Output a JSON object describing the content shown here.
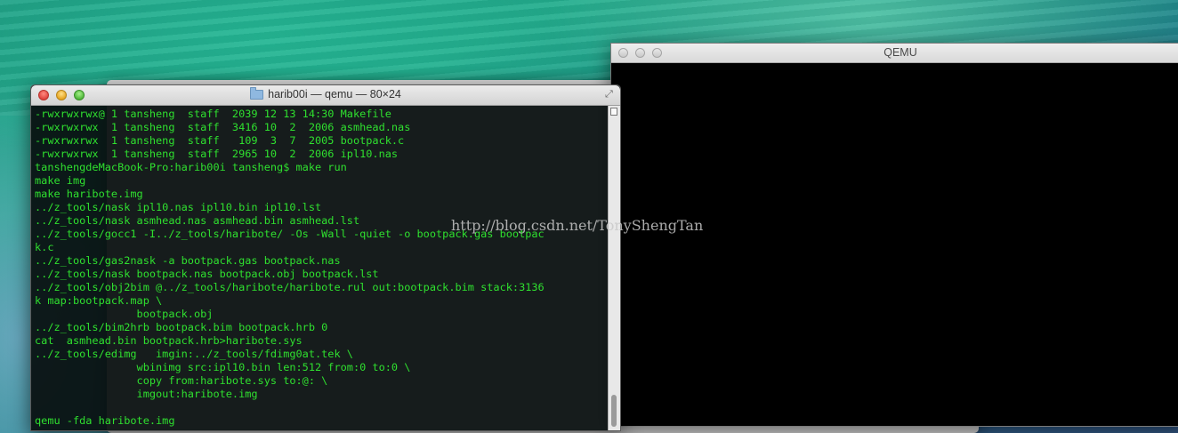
{
  "qemu_window": {
    "title": "QEMU"
  },
  "terminal": {
    "title": "harib00i — qemu — 80×24",
    "lines": [
      "-rwxrwxrwx@ 1 tansheng  staff  2039 12 13 14:30 Makefile",
      "-rwxrwxrwx  1 tansheng  staff  3416 10  2  2006 asmhead.nas",
      "-rwxrwxrwx  1 tansheng  staff   109  3  7  2005 bootpack.c",
      "-rwxrwxrwx  1 tansheng  staff  2965 10  2  2006 ipl10.nas",
      "tanshengdeMacBook-Pro:harib00i tansheng$ make run",
      "make img",
      "make haribote.img",
      "../z_tools/nask ipl10.nas ipl10.bin ipl10.lst",
      "../z_tools/nask asmhead.nas asmhead.bin asmhead.lst",
      "../z_tools/gocc1 -I../z_tools/haribote/ -Os -Wall -quiet -o bootpack.gas bootpac",
      "k.c",
      "../z_tools/gas2nask -a bootpack.gas bootpack.nas",
      "../z_tools/nask bootpack.nas bootpack.obj bootpack.lst",
      "../z_tools/obj2bim @../z_tools/haribote/haribote.rul out:bootpack.bim stack:3136",
      "k map:bootpack.map \\",
      "                bootpack.obj",
      "../z_tools/bim2hrb bootpack.bim bootpack.hrb 0",
      "cat  asmhead.bin bootpack.hrb>haribote.sys",
      "../z_tools/edimg   imgin:../z_tools/fdimg0at.tek \\",
      "                wbinimg src:ipl10.bin len:512 from:0 to:0 \\",
      "                copy from:haribote.sys to:@: \\",
      "                imgout:haribote.img",
      "",
      "qemu -fda haribote.img"
    ]
  },
  "watermark": "http://blog.csdn.net/TonyShengTan",
  "colors": {
    "terminal_text": "#2fe02f",
    "terminal_bg": "#080e0e",
    "qemu_screen": "#000000"
  }
}
